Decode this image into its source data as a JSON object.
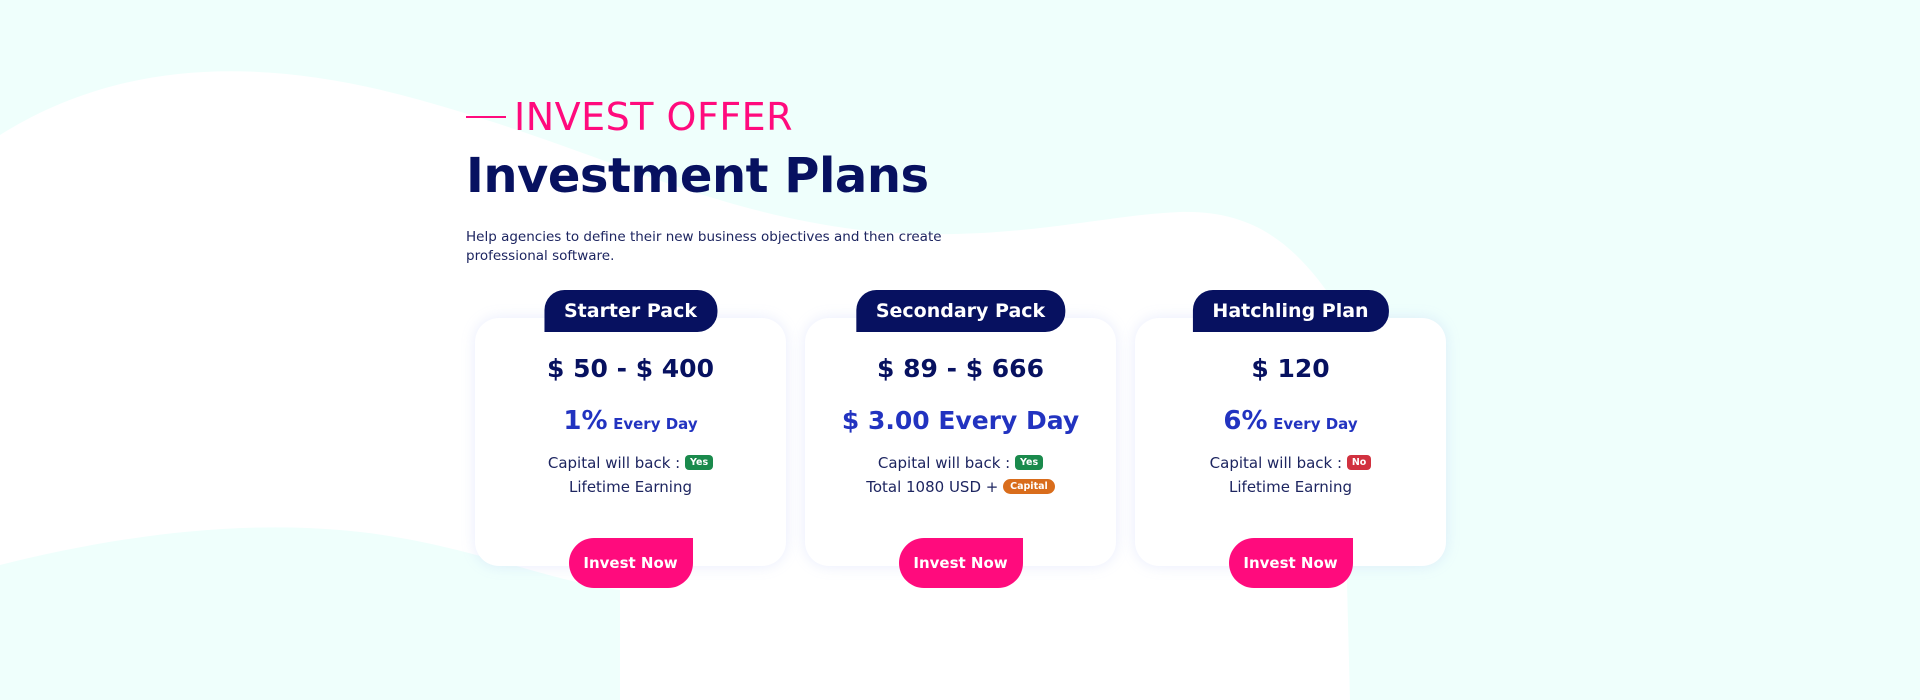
{
  "section": {
    "eyebrow": "INVEST OFFER",
    "title": "Investment Plans",
    "description": "Help agencies to define their new business objectives and then create professional software."
  },
  "plans": [
    {
      "name": "Starter Pack",
      "price": "$ 50 - $ 400",
      "rate_value": "1%",
      "rate_label": "Every Day",
      "capital_label": "Capital will back :",
      "capital_badge": "Yes",
      "extra_line": "Lifetime Earning",
      "button": "Invest Now"
    },
    {
      "name": "Secondary Pack",
      "price": "$ 89 - $ 666",
      "rate_full": "$ 3.00 Every Day",
      "capital_label": "Capital will back :",
      "capital_badge": "Yes",
      "extra_line": "Total 1080 USD +",
      "extra_badge": "Capital",
      "button": "Invest Now"
    },
    {
      "name": "Hatchling Plan",
      "price": "$ 120",
      "rate_value": "6%",
      "rate_label": "Every Day",
      "capital_label": "Capital will back :",
      "capital_badge": "No",
      "extra_line": "Lifetime Earning",
      "button": "Invest Now"
    }
  ],
  "colors": {
    "accent": "#ff0b7d",
    "navy": "#071160",
    "rate_blue": "#2233c0",
    "badge_yes": "#1a8a4c",
    "badge_no": "#d1313f",
    "badge_capital": "#d96d1c",
    "background": "#effffc"
  }
}
